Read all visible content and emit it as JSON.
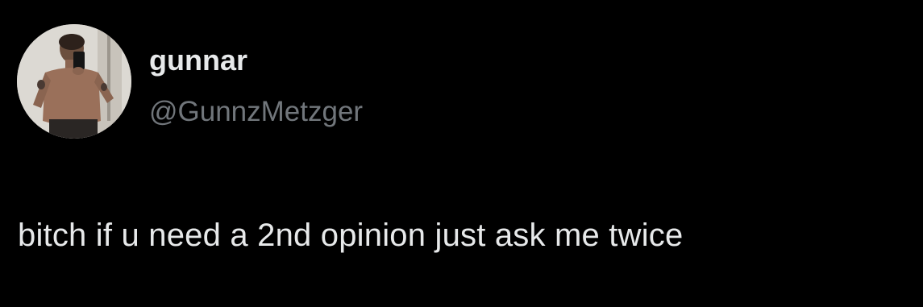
{
  "author": {
    "display_name": "gunnar",
    "handle": "@GunnzMetzger",
    "avatar_icon": "profile-photo-avatar"
  },
  "tweet": {
    "text": "bitch if u need a 2nd opinion just ask me twice"
  },
  "colors": {
    "background": "#000000",
    "primary_text": "#e7e9ea",
    "secondary_text": "#71767b"
  }
}
